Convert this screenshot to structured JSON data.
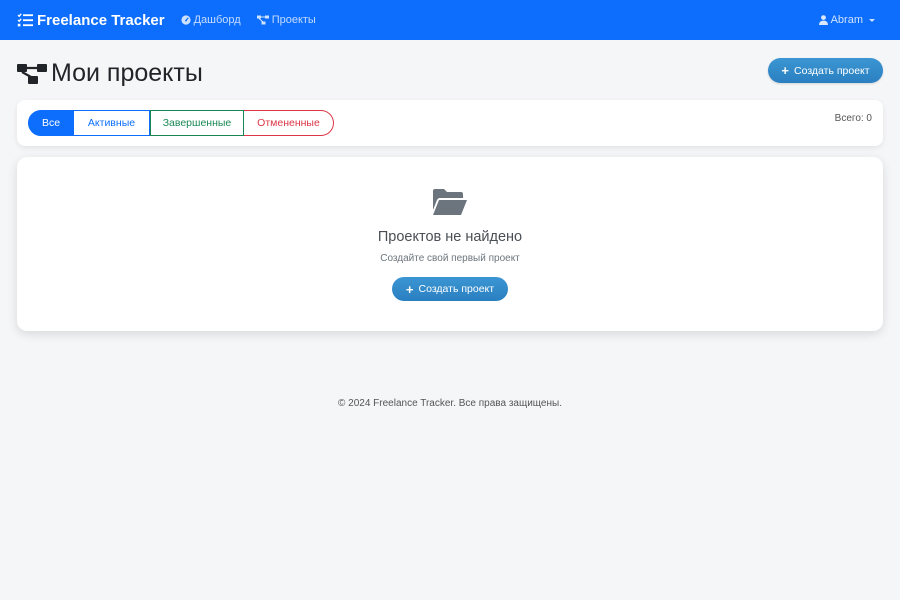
{
  "navbar": {
    "brand": "Freelance Tracker",
    "links": [
      {
        "label": "Дашборд",
        "icon": "tachometer-icon"
      },
      {
        "label": "Проекты",
        "icon": "project-diagram-icon"
      }
    ],
    "user": {
      "name": "Abram",
      "icon": "user-icon"
    }
  },
  "header": {
    "title": "Мои проекты",
    "create_button": "Создать проект"
  },
  "filters": {
    "buttons": [
      "Все",
      "Активные",
      "Завершенные",
      "Отмененные"
    ],
    "selected": "Все",
    "total": "Всего: 0"
  },
  "empty_state": {
    "title": "Проектов не найдено",
    "subtitle": "Создайте свой первый проект",
    "button": "Создать проект"
  },
  "footer": {
    "text": "© 2024 Freelance Tracker. Все права защищены."
  },
  "colors": {
    "primary": "#0d6efd",
    "success": "#198754",
    "danger": "#dc3545",
    "button_gradient": "#2a7fc0",
    "background": "#f5f6f8"
  }
}
